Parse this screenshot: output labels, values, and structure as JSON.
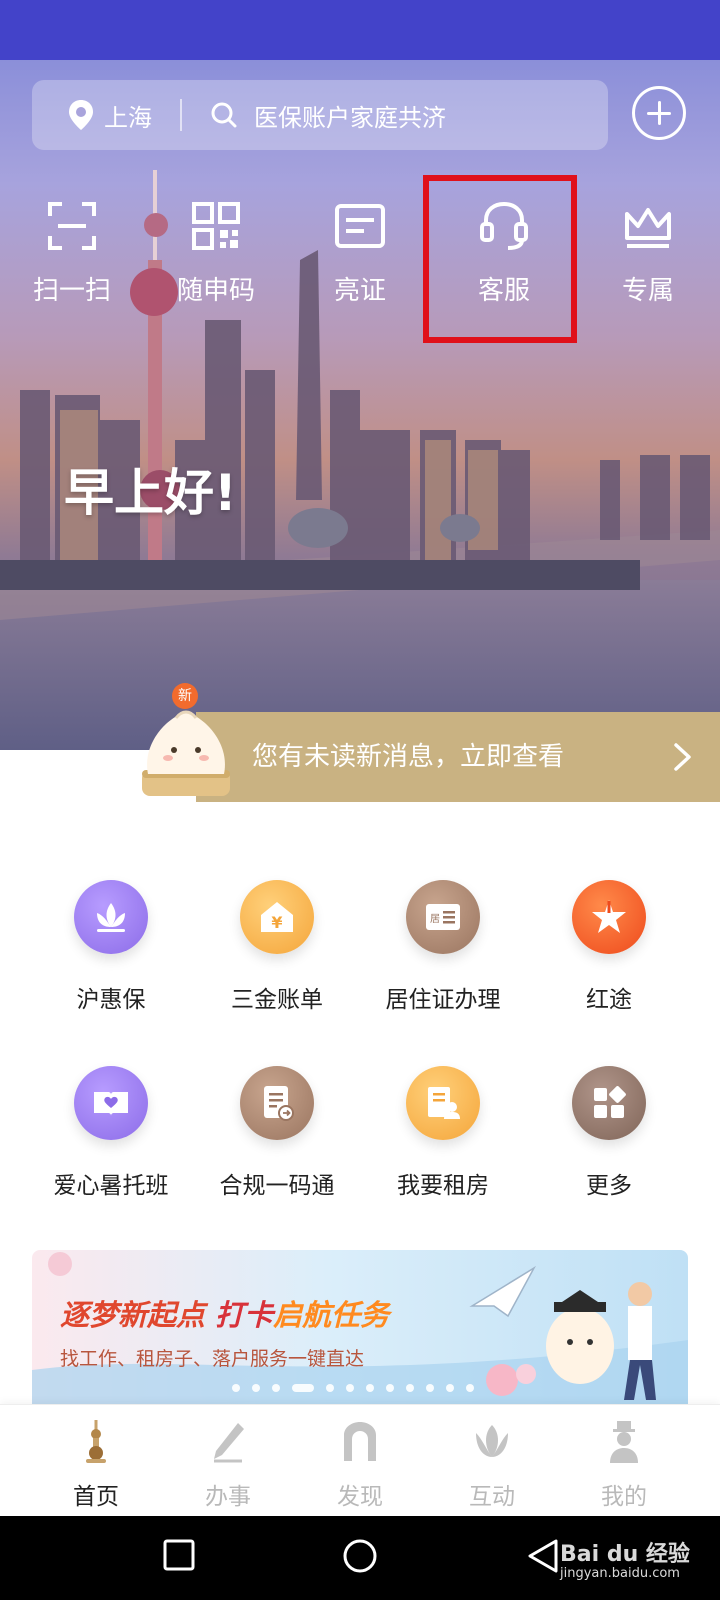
{
  "header": {
    "city": "上海",
    "search_text": "医保账户家庭共济"
  },
  "quick_actions": [
    {
      "label": "扫一扫",
      "icon": "scan-icon"
    },
    {
      "label": "随申码",
      "icon": "qr-code-icon"
    },
    {
      "label": "亮证",
      "icon": "card-icon"
    },
    {
      "label": "客服",
      "icon": "headset-icon"
    },
    {
      "label": "专属",
      "icon": "crown-icon"
    }
  ],
  "greeting": "早上好!",
  "message_banner": {
    "badge": "新",
    "text": "您有未读新消息，立即查看"
  },
  "services": [
    {
      "label": "沪惠保",
      "icon": "lotus-icon",
      "color": "#9b7bef"
    },
    {
      "label": "三金账单",
      "icon": "yen-house-icon",
      "color": "#f7b451"
    },
    {
      "label": "居住证办理",
      "icon": "residence-card-icon",
      "color": "#a9826b"
    },
    {
      "label": "红途",
      "icon": "star-flag-icon",
      "color": "#f25a2a"
    },
    {
      "label": "爱心暑托班",
      "icon": "heart-book-icon",
      "color": "#9b7bef"
    },
    {
      "label": "合规一码通",
      "icon": "document-icon",
      "color": "#a9826b"
    },
    {
      "label": "我要租房",
      "icon": "rent-house-icon",
      "color": "#f7b451"
    },
    {
      "label": "更多",
      "icon": "grid-more-icon",
      "color": "#8e7467"
    }
  ],
  "promo": {
    "title_part1": "逐梦新起点 ",
    "title_part2": "打卡",
    "title_part3": "启航任务",
    "subtitle": "找工作、租房子、落户服务一键直达"
  },
  "tabs": [
    {
      "label": "首页",
      "icon": "home-tower-icon",
      "active": true
    },
    {
      "label": "办事",
      "icon": "pen-icon",
      "active": false
    },
    {
      "label": "发现",
      "icon": "arch-icon",
      "active": false
    },
    {
      "label": "互动",
      "icon": "magnolia-icon",
      "active": false
    },
    {
      "label": "我的",
      "icon": "person-icon",
      "active": false
    }
  ],
  "watermark": {
    "brand": "Bai du 经验",
    "url": "jingyan.baidu.com"
  }
}
